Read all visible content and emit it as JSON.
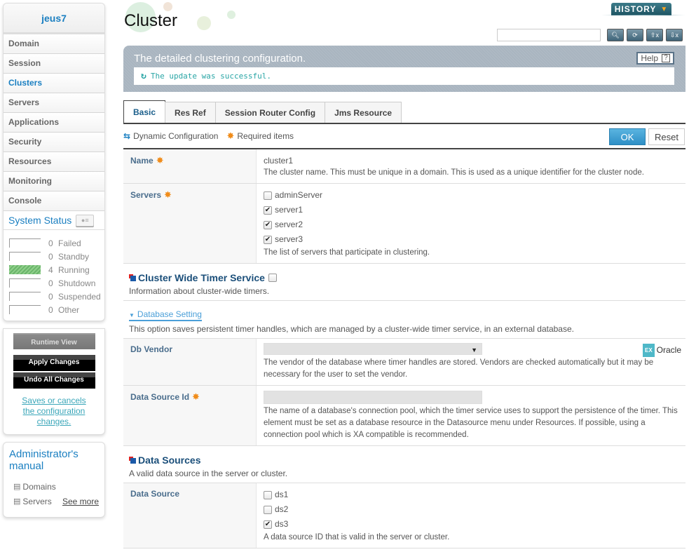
{
  "sidebar": {
    "title": "jeus7",
    "nav": [
      {
        "label": "Domain",
        "active": false
      },
      {
        "label": "Session",
        "active": false
      },
      {
        "label": "Clusters",
        "active": true
      },
      {
        "label": "Servers",
        "active": false
      },
      {
        "label": "Applications",
        "active": false
      },
      {
        "label": "Security",
        "active": false
      },
      {
        "label": "Resources",
        "active": false
      },
      {
        "label": "Monitoring",
        "active": false
      },
      {
        "label": "Console",
        "active": false
      }
    ],
    "system_status": {
      "title": "System Status",
      "rows": [
        {
          "count": "0",
          "label": "Failed"
        },
        {
          "count": "0",
          "label": "Standby"
        },
        {
          "count": "4",
          "label": "Running"
        },
        {
          "count": "0",
          "label": "Shutdown"
        },
        {
          "count": "0",
          "label": "Suspended"
        },
        {
          "count": "0",
          "label": "Other"
        }
      ]
    },
    "actions": {
      "runtime_view": "Runtime View",
      "apply_changes": "Apply Changes",
      "undo_all": "Undo All Changes",
      "note": "Saves or cancels the configuration changes."
    },
    "manual": {
      "title": "Administrator's manual",
      "links": [
        "Domains",
        "Servers"
      ],
      "see_more": "See more"
    }
  },
  "header": {
    "title": "Cluster",
    "history_label": "HISTORY",
    "search_placeholder": "",
    "toolbar_icons": [
      "search-icon",
      "refresh-icon",
      "xml-upload-icon",
      "xml-download-icon"
    ]
  },
  "description": {
    "title": "The detailed clustering configuration.",
    "help_label": "Help",
    "message": "The update was successful."
  },
  "tabs": [
    {
      "label": "Basic",
      "active": true
    },
    {
      "label": "Res Ref",
      "active": false
    },
    {
      "label": "Session Router Config",
      "active": false
    },
    {
      "label": "Jms Resource",
      "active": false
    }
  ],
  "legend": {
    "dynamic": "Dynamic Configuration",
    "required": "Required items"
  },
  "buttons": {
    "ok": "OK",
    "reset": "Reset"
  },
  "form": {
    "name": {
      "label": "Name",
      "value": "cluster1",
      "help": "The cluster name. This must be unique in a domain. This is used as a unique identifier for the cluster node."
    },
    "servers": {
      "label": "Servers",
      "options": [
        {
          "label": "adminServer",
          "checked": false
        },
        {
          "label": "server1",
          "checked": true
        },
        {
          "label": "server2",
          "checked": true
        },
        {
          "label": "server3",
          "checked": true
        }
      ],
      "help": "The list of servers that participate in clustering."
    },
    "timer_service": {
      "title": "Cluster Wide Timer Service",
      "checked": false,
      "desc": "Information about cluster-wide timers."
    },
    "database_setting": {
      "title": "Database Setting",
      "desc": "This option saves persistent timer handles, which are managed by a cluster-wide timer service, in an external database."
    },
    "db_vendor": {
      "label": "Db Vendor",
      "value": "",
      "example_badge": "EX",
      "example": "Oracle",
      "help": "The vendor of the database where timer handles are stored. Vendors are checked automatically but it may be necessary for the user to set the vendor."
    },
    "data_source_id": {
      "label": "Data Source Id",
      "value": "",
      "help": "The name of a database's connection pool, which the timer service uses to support the persistence of the timer. This element must be set as a database resource in the Datasource menu under Resources. If possible, using a connection pool which is XA compatible is recommended."
    },
    "data_sources": {
      "title": "Data Sources",
      "desc": "A valid data source in the server or cluster."
    },
    "data_source": {
      "label": "Data Source",
      "options": [
        {
          "label": "ds1",
          "checked": false
        },
        {
          "label": "ds2",
          "checked": false
        },
        {
          "label": "ds3",
          "checked": true
        }
      ],
      "help": "A data source ID that is valid in the server or cluster."
    }
  },
  "colors": {
    "accent": "#1a7fc1",
    "ok_button": "#2e8fc6",
    "required": "#f08c1a",
    "success": "#2aa6a6",
    "running": "#6bb56b"
  }
}
